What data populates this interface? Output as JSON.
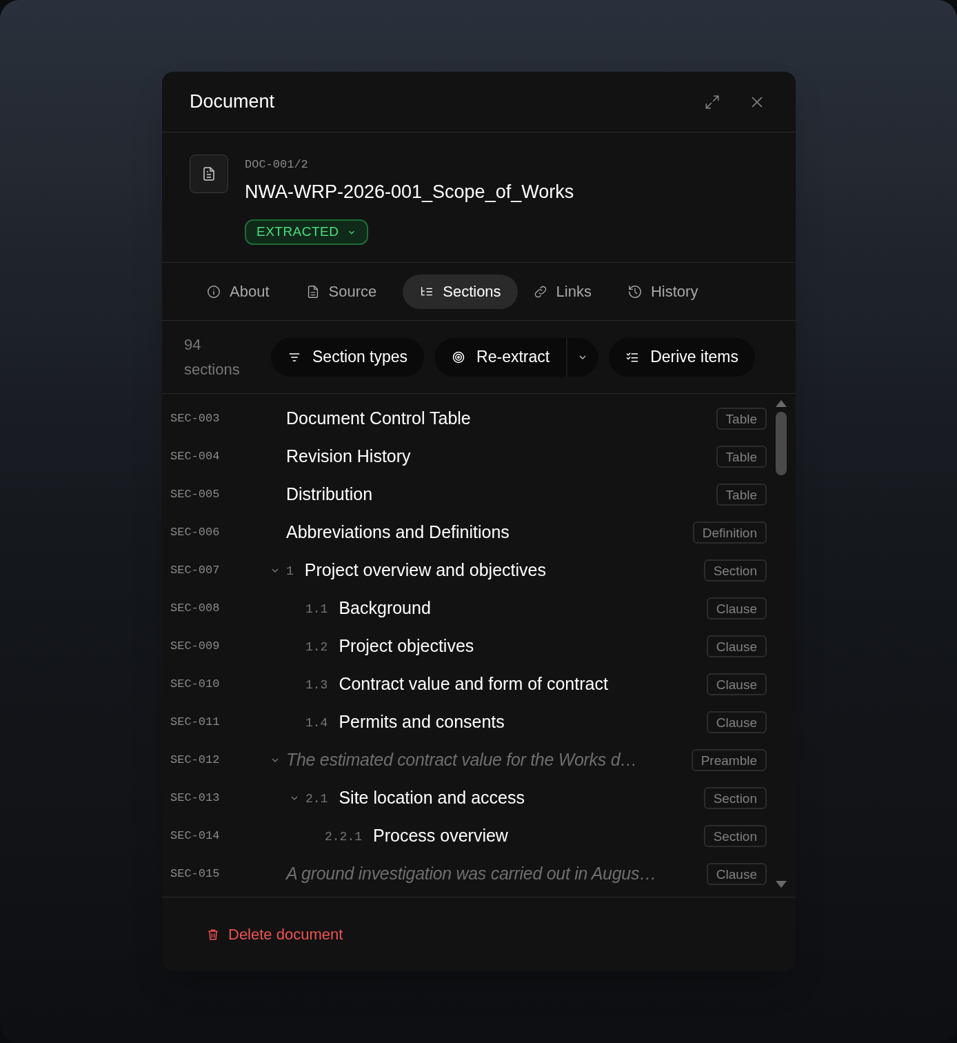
{
  "dialog": {
    "title": "Document"
  },
  "document": {
    "code": "DOC-001/2",
    "name": "NWA-WRP-2026-001_Scope_of_Works",
    "status": "EXTRACTED"
  },
  "tabs": [
    {
      "label": "About",
      "selected": false
    },
    {
      "label": "Source",
      "selected": false
    },
    {
      "label": "Sections",
      "selected": true
    },
    {
      "label": "Links",
      "selected": false
    },
    {
      "label": "History",
      "selected": false
    }
  ],
  "toolbar": {
    "count": "94",
    "count_label": "sections",
    "buttons": [
      {
        "label": "Section types",
        "kind": "plain"
      },
      {
        "label": "Re-extract",
        "kind": "split"
      },
      {
        "label": "Derive items",
        "kind": "plain"
      }
    ]
  },
  "sections": [
    {
      "id": "SEC-003",
      "kind": "heading",
      "title": "Document Control Table",
      "type": "Table"
    },
    {
      "id": "SEC-004",
      "kind": "heading",
      "title": "Revision History",
      "type": "Table"
    },
    {
      "id": "SEC-005",
      "kind": "heading",
      "title": "Distribution",
      "type": "Table"
    },
    {
      "id": "SEC-006",
      "kind": "heading",
      "title": "Abbreviations and Definitions",
      "type": "Definition"
    },
    {
      "id": "SEC-007",
      "kind": "heading",
      "number": "1",
      "title": "Project overview and objectives",
      "type": "Section",
      "expanded": true,
      "children": [
        {
          "id": "SEC-008",
          "kind": "heading",
          "number": "1.1",
          "title": "Background",
          "type": "Clause"
        },
        {
          "id": "SEC-009",
          "kind": "heading",
          "number": "1.2",
          "title": "Project objectives",
          "type": "Clause"
        },
        {
          "id": "SEC-010",
          "kind": "heading",
          "number": "1.3",
          "title": "Contract value and form of contract",
          "type": "Clause"
        },
        {
          "id": "SEC-011",
          "kind": "heading",
          "number": "1.4",
          "title": "Permits and consents",
          "type": "Clause"
        }
      ]
    },
    {
      "id": "SEC-012",
      "kind": "excerpt",
      "title": "The estimated contract value for the Works d…",
      "type": "Preamble",
      "expanded": true,
      "children": [
        {
          "id": "SEC-013",
          "kind": "heading",
          "number": "2.1",
          "title": "Site location and access",
          "type": "Section",
          "expanded": true,
          "children": [
            {
              "id": "SEC-014",
              "kind": "heading",
              "number": "2.2.1",
              "title": "Process overview",
              "type": "Section"
            }
          ]
        }
      ]
    },
    {
      "id": "SEC-015",
      "kind": "excerpt",
      "title": "A ground investigation was carried out in Augus…",
      "type": "Clause"
    }
  ],
  "footer": {
    "delete": "Delete document"
  }
}
